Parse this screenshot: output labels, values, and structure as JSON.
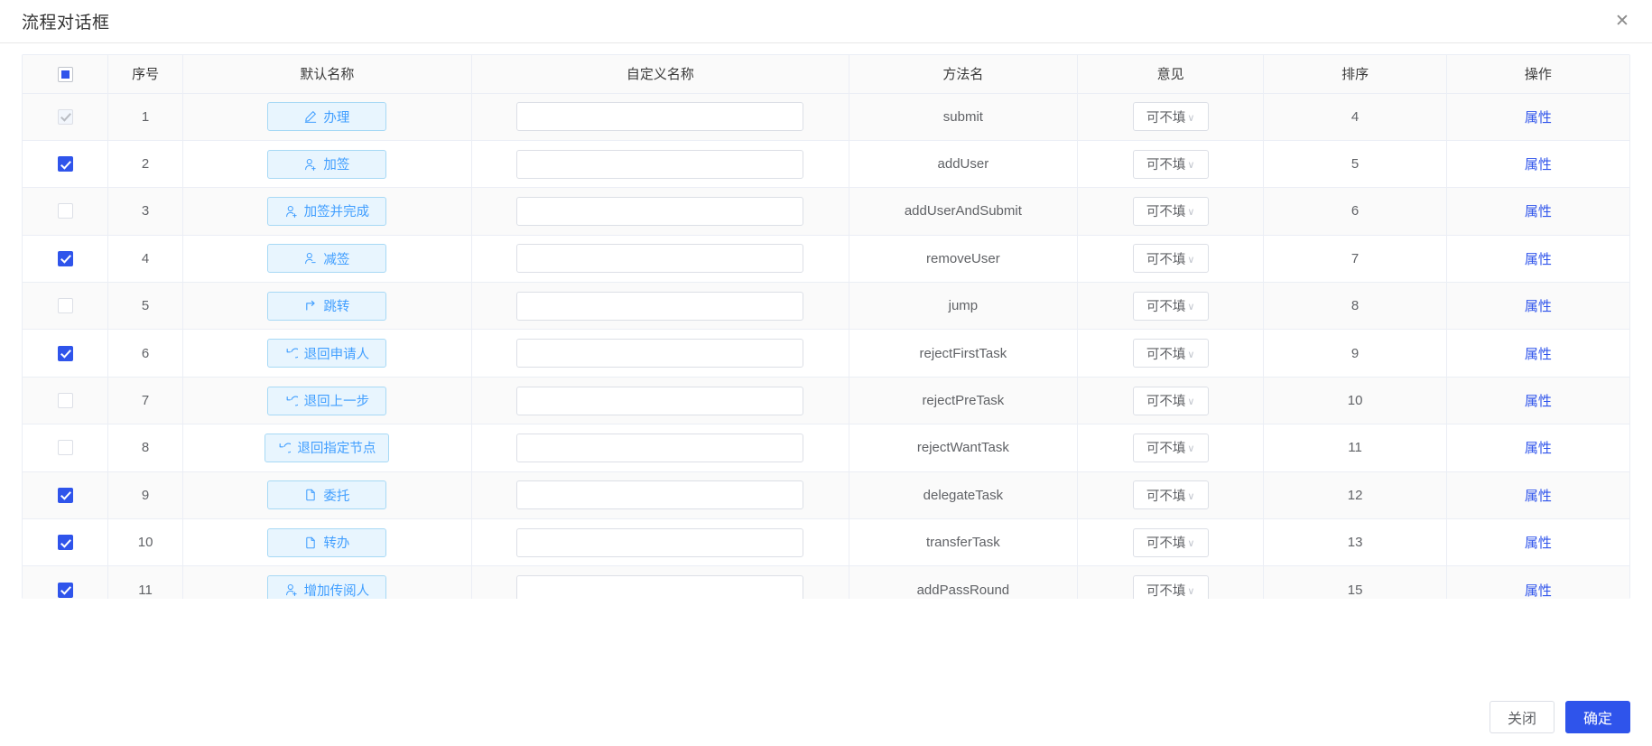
{
  "dialog": {
    "title": "流程对话框",
    "close_icon": "close-icon",
    "close_glyph": "✕"
  },
  "table": {
    "header_checkbox_state": "indeterminate",
    "columns": [
      {
        "key": "check",
        "label": ""
      },
      {
        "key": "index",
        "label": "序号"
      },
      {
        "key": "defname",
        "label": "默认名称"
      },
      {
        "key": "custname",
        "label": "自定义名称"
      },
      {
        "key": "method",
        "label": "方法名"
      },
      {
        "key": "opinion",
        "label": "意见"
      },
      {
        "key": "sort",
        "label": "排序"
      },
      {
        "key": "action",
        "label": "操作"
      }
    ],
    "opinion_value": "可不填",
    "action_label": "属性",
    "custom_name_value": "",
    "custom_name_placeholder": "",
    "rows": [
      {
        "index": "1",
        "checked": true,
        "disabled": true,
        "name": "办理",
        "icon": "pencil-icon",
        "method": "submit",
        "opinion": "可不填",
        "sort": "4",
        "action": "属性"
      },
      {
        "index": "2",
        "checked": true,
        "disabled": false,
        "name": "加签",
        "icon": "user-add-icon",
        "method": "addUser",
        "opinion": "可不填",
        "sort": "5",
        "action": "属性"
      },
      {
        "index": "3",
        "checked": false,
        "disabled": false,
        "name": "加签并完成",
        "icon": "user-add-icon",
        "method": "addUserAndSubmit",
        "opinion": "可不填",
        "sort": "6",
        "action": "属性"
      },
      {
        "index": "4",
        "checked": true,
        "disabled": false,
        "name": "减签",
        "icon": "user-remove-icon",
        "method": "removeUser",
        "opinion": "可不填",
        "sort": "7",
        "action": "属性"
      },
      {
        "index": "5",
        "checked": false,
        "disabled": false,
        "name": "跳转",
        "icon": "jump-arrow-icon",
        "method": "jump",
        "opinion": "可不填",
        "sort": "8",
        "action": "属性"
      },
      {
        "index": "6",
        "checked": true,
        "disabled": false,
        "name": "退回申请人",
        "icon": "undo-icon",
        "method": "rejectFirstTask",
        "opinion": "可不填",
        "sort": "9",
        "action": "属性"
      },
      {
        "index": "7",
        "checked": false,
        "disabled": false,
        "name": "退回上一步",
        "icon": "undo-icon",
        "method": "rejectPreTask",
        "opinion": "可不填",
        "sort": "10",
        "action": "属性"
      },
      {
        "index": "8",
        "checked": false,
        "disabled": false,
        "name": "退回指定节点",
        "icon": "undo-icon",
        "method": "rejectWantTask",
        "opinion": "可不填",
        "sort": "11",
        "action": "属性"
      },
      {
        "index": "9",
        "checked": true,
        "disabled": false,
        "name": "委托",
        "icon": "document-icon",
        "method": "delegateTask",
        "opinion": "可不填",
        "sort": "12",
        "action": "属性"
      },
      {
        "index": "10",
        "checked": true,
        "disabled": false,
        "name": "转办",
        "icon": "document-icon",
        "method": "transferTask",
        "opinion": "可不填",
        "sort": "13",
        "action": "属性"
      },
      {
        "index": "11",
        "checked": true,
        "disabled": false,
        "name": "增加传阅人",
        "icon": "user-add-icon",
        "method": "addPassRound",
        "opinion": "可不填",
        "sort": "15",
        "action": "属性"
      }
    ]
  },
  "footer": {
    "close_label": "关闭",
    "confirm_label": "确定"
  },
  "colors": {
    "primary": "#2f54eb",
    "link": "#2f54eb",
    "tag_bg": "#e8f5fe",
    "tag_border": "#a7d9f5",
    "tag_text": "#409eff",
    "border": "#ebeef5",
    "stripe": "#fafafa"
  }
}
